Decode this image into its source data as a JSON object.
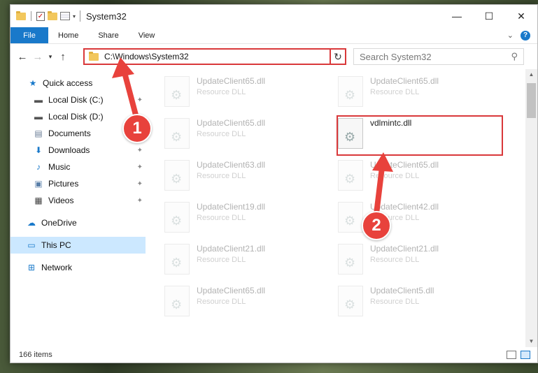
{
  "window": {
    "title": "System32",
    "controls": {
      "minimize": "—",
      "maximize": "☐",
      "close": "✕"
    }
  },
  "ribbon": {
    "tabs": [
      "File",
      "Home",
      "Share",
      "View"
    ],
    "expand_icon": "⌄",
    "help_icon": "?"
  },
  "nav": {
    "back": "←",
    "forward": "→",
    "recent": "▾",
    "up": "↑",
    "address": "C:\\Windows\\System32",
    "dropdown": "⌄",
    "refresh": "↻",
    "search_placeholder": "Search System32",
    "search_icon": "⚲"
  },
  "sidebar": {
    "items": [
      {
        "label": "Quick access",
        "icon": "star-icon",
        "glyph": "★",
        "color": "#1979ca",
        "pinned": false
      },
      {
        "label": "Local Disk (C:)",
        "icon": "drive-icon",
        "glyph": "▬",
        "color": "#555",
        "pinned": true
      },
      {
        "label": "Local Disk (D:)",
        "icon": "drive-icon",
        "glyph": "▬",
        "color": "#555",
        "pinned": true
      },
      {
        "label": "Documents",
        "icon": "documents-icon",
        "glyph": "▤",
        "color": "#6a7d96",
        "pinned": true
      },
      {
        "label": "Downloads",
        "icon": "downloads-icon",
        "glyph": "⬇",
        "color": "#1979ca",
        "pinned": true
      },
      {
        "label": "Music",
        "icon": "music-icon",
        "glyph": "♪",
        "color": "#1979ca",
        "pinned": true
      },
      {
        "label": "Pictures",
        "icon": "pictures-icon",
        "glyph": "▣",
        "color": "#5a7fa8",
        "pinned": true
      },
      {
        "label": "Videos",
        "icon": "videos-icon",
        "glyph": "▦",
        "color": "#444",
        "pinned": true
      },
      {
        "label": "OneDrive",
        "icon": "onedrive-icon",
        "glyph": "☁",
        "color": "#1979ca",
        "pinned": false
      },
      {
        "label": "This PC",
        "icon": "pc-icon",
        "glyph": "▭",
        "color": "#1979ca",
        "pinned": false
      },
      {
        "label": "Network",
        "icon": "network-icon",
        "glyph": "⊞",
        "color": "#1979ca",
        "pinned": false
      }
    ],
    "pin_glyph": "📌"
  },
  "files": {
    "left_column": [
      {
        "name": "UpdateClient65.dll",
        "type": "Resource DLL"
      },
      {
        "name": "UpdateClient65.dll",
        "type": "Resource DLL"
      },
      {
        "name": "UpdateClient63.dll",
        "type": "Resource DLL"
      },
      {
        "name": "UpdateClient19.dll",
        "type": "Resource DLL"
      },
      {
        "name": "UpdateClient21.dll",
        "type": "Resource DLL"
      },
      {
        "name": "UpdateClient65.dll",
        "type": "Resource DLL"
      }
    ],
    "right_column": [
      {
        "name": "UpdateClient65.dll",
        "type": "Resource DLL"
      },
      {
        "name": "vdlmintc.dll",
        "type": ""
      },
      {
        "name": "UpdateClient65.dll",
        "type": "Resource DLL"
      },
      {
        "name": "UpdateClient42.dll",
        "type": "Resource DLL"
      },
      {
        "name": "UpdateClient21.dll",
        "type": "Resource DLL"
      },
      {
        "name": "UpdateClient5.dll",
        "type": "Resource DLL"
      }
    ]
  },
  "status": {
    "item_count": "166 items"
  },
  "annotations": {
    "badge1": "1",
    "badge2": "2",
    "color": "#e8423c"
  }
}
